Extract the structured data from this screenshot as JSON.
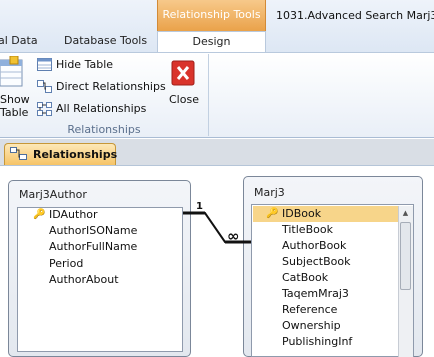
{
  "window": {
    "context_tab_header": "Relationship Tools",
    "doc_title": "1031.Advanced Search Marj3 :"
  },
  "tabs": [
    {
      "label": "al Data"
    },
    {
      "label": "Database Tools"
    },
    {
      "label": "Design"
    }
  ],
  "ribbon": {
    "show_table_label_1": "Show",
    "show_table_label_2": "Table",
    "hide_table": "Hide Table",
    "direct_relationships": "Direct Relationships",
    "all_relationships": "All Relationships",
    "close": "Close",
    "group_label": "Relationships"
  },
  "document_tab": {
    "label": "Relationships"
  },
  "tables": [
    {
      "name": "Marj3Author",
      "fields": [
        "IDAuthor",
        "AuthorISOName",
        "AuthorFullName",
        "Period",
        "AuthorAbout"
      ]
    },
    {
      "name": "Marj3",
      "fields": [
        "IDBook",
        "TitleBook",
        "AuthorBook",
        "SubjectBook",
        "CatBook",
        "TaqemMraj3",
        "Reference",
        "Ownership",
        "PublishingInf"
      ]
    }
  ],
  "relationship": {
    "one_label": "1",
    "many_label": "∞"
  },
  "colors": {
    "context_accent": "#eaa24a",
    "selection": "#f7d58a"
  }
}
